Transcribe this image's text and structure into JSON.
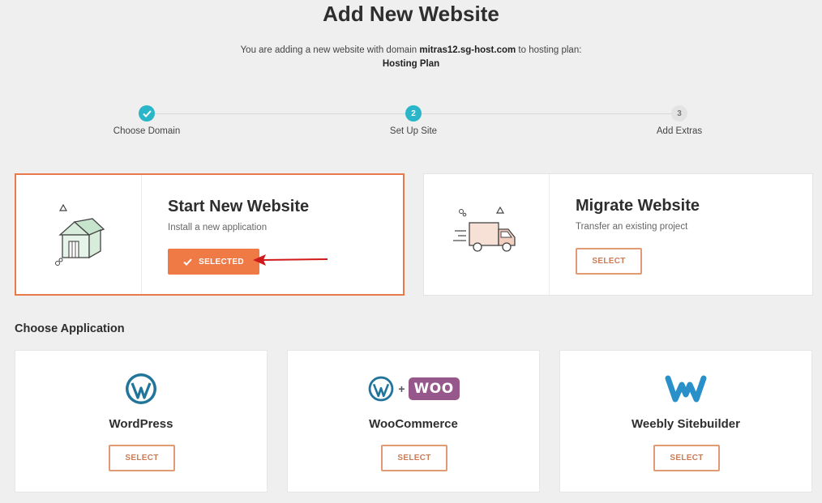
{
  "header": {
    "title": "Add New Website",
    "intro_prefix": "You are adding a new website with domain ",
    "domain": "mitras12.sg-host.com",
    "intro_suffix": " to hosting plan:",
    "plan": "Hosting Plan"
  },
  "steps": [
    {
      "number": "",
      "label": "Choose Domain",
      "state": "done"
    },
    {
      "number": "2",
      "label": "Set Up Site",
      "state": "active"
    },
    {
      "number": "3",
      "label": "Add Extras",
      "state": "pending"
    }
  ],
  "modes": [
    {
      "title": "Start New Website",
      "subtitle": "Install a new application",
      "button": "SELECTED",
      "selected": true,
      "icon": "house-icon"
    },
    {
      "title": "Migrate Website",
      "subtitle": "Transfer an existing project",
      "button": "SELECT",
      "selected": false,
      "icon": "truck-icon"
    }
  ],
  "applications": {
    "heading": "Choose Application",
    "items": [
      {
        "name": "WordPress",
        "button": "SELECT",
        "icon": "wordpress-icon"
      },
      {
        "name": "WooCommerce",
        "button": "SELECT",
        "icon": "woocommerce-icon",
        "plus": "+",
        "logo_text": "WOO"
      },
      {
        "name": "Weebly Sitebuilder",
        "button": "SELECT",
        "icon": "weebly-icon"
      }
    ]
  },
  "colors": {
    "accent": "#ef7a45",
    "step_active": "#2ab5c9",
    "wordpress": "#21759b",
    "woo": "#96588a",
    "weebly": "#2a90c9",
    "annotation_arrow": "#d11b1b"
  }
}
